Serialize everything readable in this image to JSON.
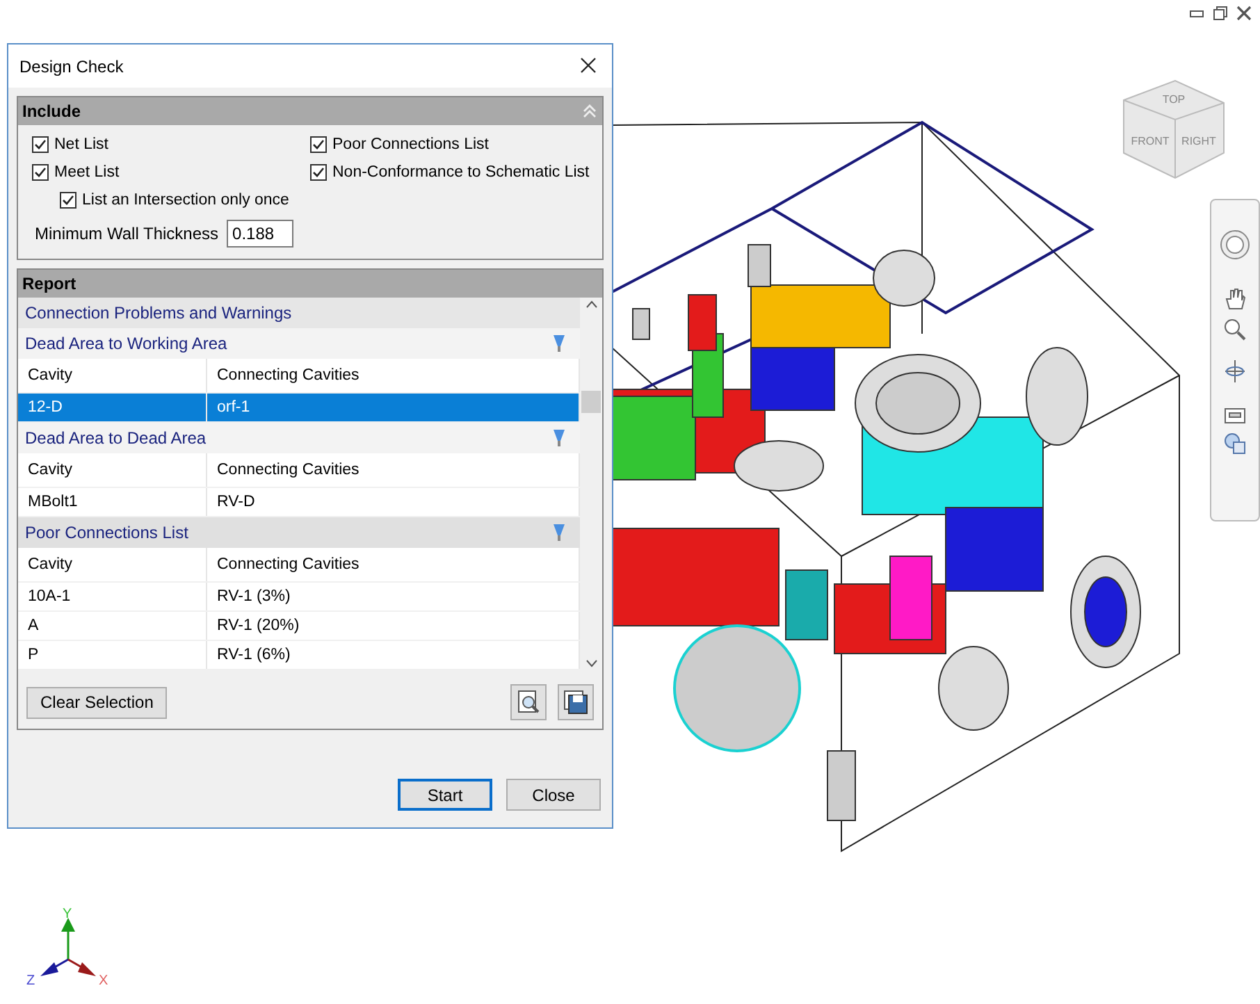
{
  "view_cube": {
    "top": "TOP",
    "front": "FRONT",
    "right": "RIGHT"
  },
  "axes": {
    "x": "X",
    "y": "Y",
    "z": "Z"
  },
  "dialog": {
    "title": "Design Check",
    "include": {
      "title": "Include",
      "options": [
        {
          "label": "Net List",
          "checked": true
        },
        {
          "label": "Meet List",
          "checked": true,
          "children": [
            {
              "label": "List an Intersection only once",
              "checked": true
            }
          ]
        }
      ],
      "options_right": [
        {
          "label": "Poor Connections List",
          "checked": true
        },
        {
          "label": "Non-Conformance to Schematic List",
          "checked": true
        }
      ],
      "wall_thickness": {
        "label": "Minimum Wall Thickness",
        "value": "0.188"
      }
    },
    "report": {
      "title": "Report",
      "items": [
        {
          "kind": "heading",
          "text": "Connection Problems and Warnings"
        },
        {
          "kind": "group",
          "title": "Dead Area to Working Area",
          "columns": [
            "Cavity",
            "Connecting Cavities"
          ],
          "rows": [
            {
              "cells": [
                "12-D",
                "orf-1"
              ],
              "selected": true
            }
          ]
        },
        {
          "kind": "group",
          "title": "Dead Area to Dead Area",
          "columns": [
            "Cavity",
            "Connecting Cavities"
          ],
          "rows": [
            {
              "cells": [
                "MBolt1",
                "RV-D"
              ],
              "selected": false
            }
          ]
        },
        {
          "kind": "list",
          "title": "Poor Connections List",
          "columns": [
            "Cavity",
            "Connecting Cavities"
          ],
          "rows": [
            {
              "cells": [
                "10A-1",
                "RV-1 (3%)"
              ],
              "selected": false
            },
            {
              "cells": [
                "A",
                "RV-1 (20%)"
              ],
              "selected": false
            },
            {
              "cells": [
                "P",
                "RV-1 (6%)"
              ],
              "selected": false
            }
          ]
        }
      ],
      "clear_button": "Clear Selection"
    },
    "buttons": [
      {
        "label": "Start",
        "default": true
      },
      {
        "label": "Close",
        "default": false
      }
    ]
  }
}
